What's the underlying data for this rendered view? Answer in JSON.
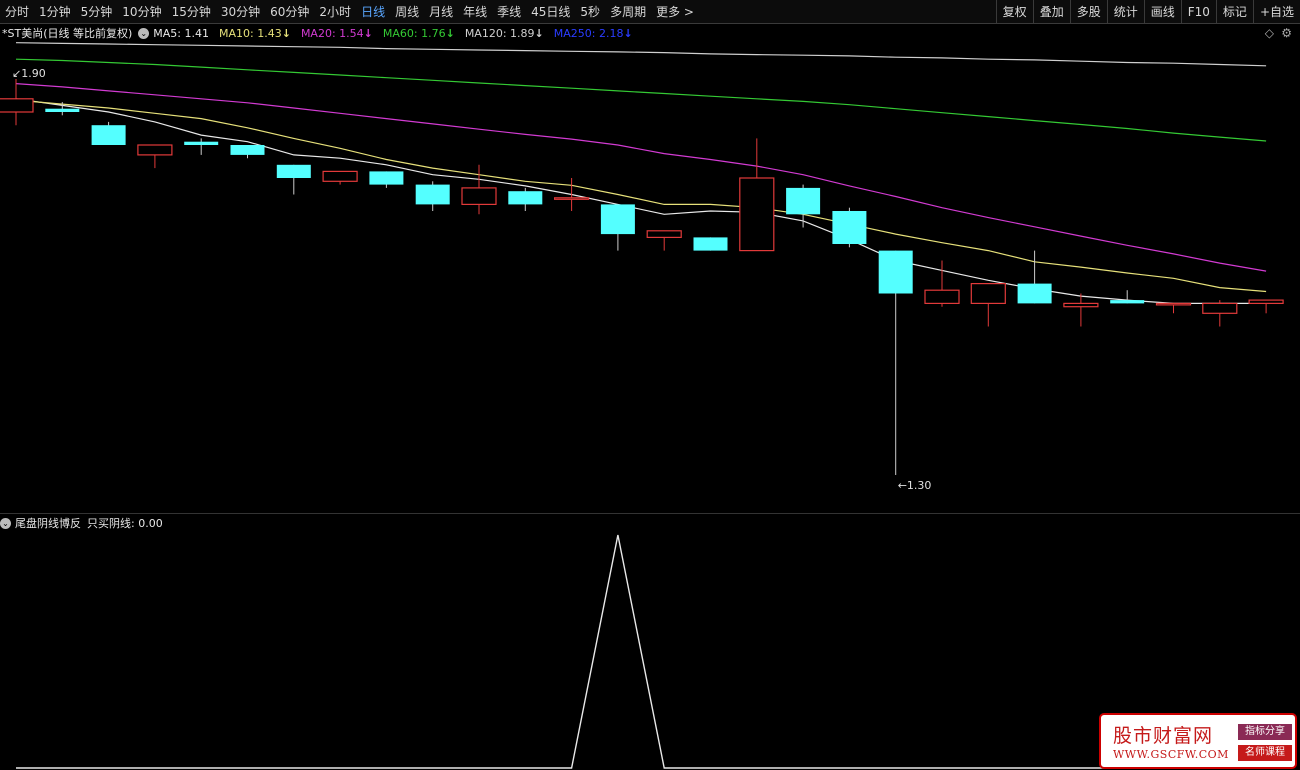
{
  "toolbar": {
    "periods": [
      "分时",
      "1分钟",
      "5分钟",
      "10分钟",
      "15分钟",
      "30分钟",
      "60分钟",
      "2小时",
      "日线",
      "周线",
      "月线",
      "年线",
      "季线",
      "45日线",
      "5秒",
      "多周期",
      "更多 >"
    ],
    "active_period": "日线",
    "tools": [
      "复权",
      "叠加",
      "多股",
      "统计",
      "画线",
      "F10",
      "标记",
      "+自选"
    ]
  },
  "info": {
    "title": "*ST美尚(日线 等比前复权)",
    "ma": [
      {
        "label": "MA5: 1.41",
        "arrow": "",
        "color": "#e8e8e8"
      },
      {
        "label": "MA10: 1.43",
        "arrow": "↓",
        "color": "#e6e07a"
      },
      {
        "label": "MA20: 1.54",
        "arrow": "↓",
        "color": "#d23bd2"
      },
      {
        "label": "MA60: 1.76",
        "arrow": "↓",
        "color": "#34c934"
      },
      {
        "label": "MA120: 1.89",
        "arrow": "↓",
        "color": "#cfcfcf"
      },
      {
        "label": "MA250: 2.18",
        "arrow": "↓",
        "color": "#2a3cff"
      }
    ]
  },
  "chart_data": {
    "type": "candlestick",
    "ylim": [
      1.25,
      1.95
    ],
    "max_label": "1.90",
    "min_label": "1.30",
    "up_color": "#e23a3a",
    "down_color": "#54ffff",
    "candles": [
      {
        "o": 1.85,
        "h": 1.9,
        "l": 1.83,
        "c": 1.87
      },
      {
        "o": 1.855,
        "h": 1.865,
        "l": 1.845,
        "c": 1.85
      },
      {
        "o": 1.83,
        "h": 1.835,
        "l": 1.8,
        "c": 1.8
      },
      {
        "o": 1.785,
        "h": 1.8,
        "l": 1.765,
        "c": 1.8
      },
      {
        "o": 1.805,
        "h": 1.81,
        "l": 1.785,
        "c": 1.8
      },
      {
        "o": 1.8,
        "h": 1.8,
        "l": 1.78,
        "c": 1.785
      },
      {
        "o": 1.77,
        "h": 1.77,
        "l": 1.725,
        "c": 1.75
      },
      {
        "o": 1.745,
        "h": 1.76,
        "l": 1.74,
        "c": 1.76
      },
      {
        "o": 1.76,
        "h": 1.76,
        "l": 1.735,
        "c": 1.74
      },
      {
        "o": 1.74,
        "h": 1.745,
        "l": 1.7,
        "c": 1.71
      },
      {
        "o": 1.71,
        "h": 1.77,
        "l": 1.695,
        "c": 1.735
      },
      {
        "o": 1.73,
        "h": 1.735,
        "l": 1.7,
        "c": 1.71
      },
      {
        "o": 1.72,
        "h": 1.75,
        "l": 1.7,
        "c": 1.72
      },
      {
        "o": 1.71,
        "h": 1.71,
        "l": 1.64,
        "c": 1.665
      },
      {
        "o": 1.66,
        "h": 1.67,
        "l": 1.64,
        "c": 1.67
      },
      {
        "o": 1.66,
        "h": 1.66,
        "l": 1.64,
        "c": 1.64
      },
      {
        "o": 1.64,
        "h": 1.81,
        "l": 1.64,
        "c": 1.75
      },
      {
        "o": 1.735,
        "h": 1.74,
        "l": 1.675,
        "c": 1.695
      },
      {
        "o": 1.7,
        "h": 1.705,
        "l": 1.645,
        "c": 1.65
      },
      {
        "o": 1.64,
        "h": 1.64,
        "l": 1.3,
        "c": 1.575
      },
      {
        "o": 1.56,
        "h": 1.625,
        "l": 1.555,
        "c": 1.58
      },
      {
        "o": 1.56,
        "h": 1.59,
        "l": 1.525,
        "c": 1.59
      },
      {
        "o": 1.59,
        "h": 1.64,
        "l": 1.56,
        "c": 1.56
      },
      {
        "o": 1.555,
        "h": 1.575,
        "l": 1.525,
        "c": 1.56
      },
      {
        "o": 1.565,
        "h": 1.58,
        "l": 1.56,
        "c": 1.56
      },
      {
        "o": 1.56,
        "h": 1.56,
        "l": 1.545,
        "c": 1.56
      },
      {
        "o": 1.545,
        "h": 1.565,
        "l": 1.525,
        "c": 1.56
      },
      {
        "o": 1.56,
        "h": 1.565,
        "l": 1.545,
        "c": 1.565
      }
    ],
    "ma_lines": [
      {
        "name": "MA5",
        "color": "#e8e8e8",
        "values": [
          1.87,
          1.86,
          1.85,
          1.835,
          1.815,
          1.805,
          1.785,
          1.78,
          1.77,
          1.755,
          1.748,
          1.738,
          1.725,
          1.71,
          1.695,
          1.7,
          1.698,
          1.685,
          1.657,
          1.625,
          1.61,
          1.595,
          1.582,
          1.571,
          1.565,
          1.56,
          1.56,
          1.56
        ]
      },
      {
        "name": "MA10",
        "color": "#e6e07a",
        "values": [
          1.868,
          1.862,
          1.856,
          1.848,
          1.84,
          1.826,
          1.81,
          1.795,
          1.778,
          1.765,
          1.755,
          1.745,
          1.739,
          1.725,
          1.71,
          1.71,
          1.705,
          1.695,
          1.68,
          1.665,
          1.652,
          1.64,
          1.623,
          1.615,
          1.606,
          1.598,
          1.584,
          1.578
        ]
      },
      {
        "name": "MA20",
        "color": "#d23bd2",
        "values": [
          1.893,
          1.888,
          1.882,
          1.876,
          1.87,
          1.864,
          1.856,
          1.848,
          1.84,
          1.832,
          1.824,
          1.816,
          1.809,
          1.8,
          1.787,
          1.778,
          1.768,
          1.755,
          1.738,
          1.722,
          1.705,
          1.69,
          1.676,
          1.662,
          1.648,
          1.635,
          1.621,
          1.609
        ]
      },
      {
        "name": "MA60",
        "color": "#34c934",
        "values": [
          1.93,
          1.928,
          1.925,
          1.922,
          1.918,
          1.914,
          1.91,
          1.906,
          1.902,
          1.898,
          1.894,
          1.89,
          1.886,
          1.882,
          1.878,
          1.874,
          1.87,
          1.866,
          1.861,
          1.855,
          1.849,
          1.843,
          1.837,
          1.831,
          1.825,
          1.818,
          1.812,
          1.806
        ]
      },
      {
        "name": "MA120",
        "color": "#cfcfcf",
        "values": [
          1.955,
          1.954,
          1.953,
          1.952,
          1.951,
          1.95,
          1.949,
          1.948,
          1.946,
          1.945,
          1.944,
          1.943,
          1.942,
          1.941,
          1.94,
          1.938,
          1.937,
          1.936,
          1.935,
          1.933,
          1.932,
          1.93,
          1.929,
          1.927,
          1.925,
          1.924,
          1.922,
          1.92
        ]
      }
    ]
  },
  "indicator": {
    "name": "尾盘阴线博反",
    "value_label": "只买阴线: 0.00",
    "line_color": "#e8e8e8",
    "values": [
      0,
      0,
      0,
      0,
      0,
      0,
      0,
      0,
      0,
      0,
      0,
      0,
      0,
      1,
      0,
      0,
      0,
      0,
      0,
      0,
      0,
      0,
      0,
      0,
      0,
      0,
      0,
      0
    ]
  },
  "watermark": {
    "name": "股市财富网",
    "url": "WWW.GSCFW.COM",
    "tag1": "指标分享",
    "tag2": "名师课程"
  }
}
